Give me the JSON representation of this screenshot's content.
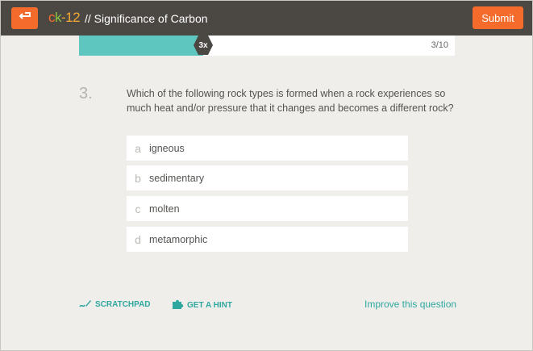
{
  "header": {
    "logo": {
      "c": "c",
      "k": "k",
      "n": "-12"
    },
    "title": "// Significance of Carbon",
    "submit_label": "Submit"
  },
  "progress": {
    "fraction": 0.3,
    "streak": "3x",
    "text": "3/10"
  },
  "question": {
    "number": "3.",
    "text": "Which of the following rock types is formed when a rock experiences so much heat and/or pressure that it changes and becomes a different rock?"
  },
  "options": [
    {
      "letter": "a",
      "text": "igneous"
    },
    {
      "letter": "b",
      "text": "sedimentary"
    },
    {
      "letter": "c",
      "text": "molten"
    },
    {
      "letter": "d",
      "text": "metamorphic"
    }
  ],
  "footer": {
    "scratchpad_label": "SCRATCHPAD",
    "hint_label": "GET A HINT",
    "improve_label": "Improve this question"
  },
  "colors": {
    "accent": "#f46b2b",
    "teal": "#5fc5bf",
    "link": "#2fa8a0",
    "header_bg": "#4b4844"
  },
  "icons": [
    "back-arrow-icon",
    "pencil-icon",
    "puzzle-icon"
  ]
}
